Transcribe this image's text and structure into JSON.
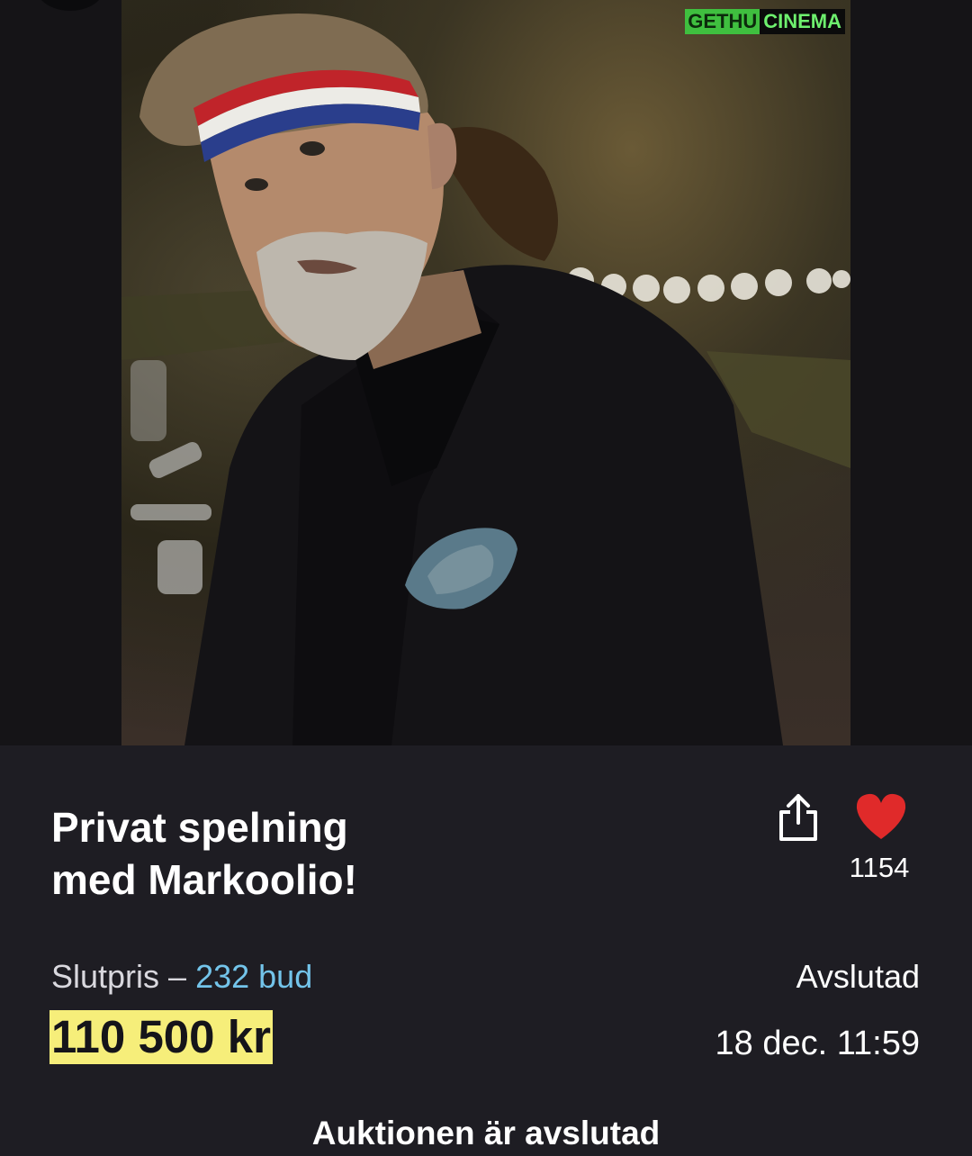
{
  "watermark": {
    "part1": "GETHU",
    "part2": "CINEMA"
  },
  "listing": {
    "title_line1": "Privat spelning",
    "title_line2": "med Markoolio!",
    "likes": "1154",
    "price_label": "Slutpris – ",
    "bids": "232 bud",
    "price": "110 500 kr",
    "status": "Avslutad",
    "end_date": "18 dec. 11:59",
    "closed_message": "Auktionen är avslutad"
  },
  "icons": {
    "share": "share-icon",
    "like": "heart-icon"
  },
  "colors": {
    "background": "#1e1d23",
    "heart": "#e02a2a",
    "bids_link": "#73c4ea",
    "price_highlight": "#f6ee7a"
  }
}
